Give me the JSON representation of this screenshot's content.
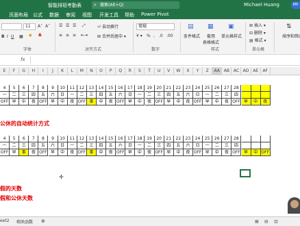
{
  "title_bar": {
    "filename": "智能排班考勤表",
    "search_placeholder": "搜索(Alt+Q)",
    "user": "Michael Huang",
    "badge": "MH"
  },
  "tabs": [
    "页面布局",
    "公式",
    "数据",
    "审阅",
    "视图",
    "开发工具",
    "帮助",
    "Power Pivot"
  ],
  "ribbon": {
    "font_size": "11",
    "wrap_text": "自动换行",
    "merge_center": "合并后居中",
    "number_format": "常规",
    "conditional_format": "条件格式",
    "format_table": "套用\n表格格式",
    "cell_styles": "单元格样式",
    "insert": "插入",
    "delete": "删除",
    "format": "格式",
    "sort_filter": "排序和筛选",
    "groups": {
      "font": "字体",
      "alignment": "对齐方式",
      "number": "数字",
      "styles": "样式",
      "cells": "单元格"
    }
  },
  "column_headers": [
    "E",
    "F",
    "G",
    "H",
    "I",
    "J",
    "K",
    "L",
    "M",
    "N",
    "O",
    "P",
    "Q",
    "R",
    "S",
    "T",
    "U",
    "V",
    "W",
    "X",
    "Y",
    "Z",
    "AA",
    "AB",
    "AC",
    "AD",
    "AE",
    "AF"
  ],
  "table1": {
    "dates": [
      "4",
      "5",
      "6",
      "7",
      "8",
      "9",
      "10",
      "11",
      "12",
      "13",
      "14",
      "15",
      "16",
      "17",
      "18",
      "19",
      "20",
      "21",
      "22",
      "23",
      "24",
      "25",
      "26",
      "27",
      "28",
      "",
      "",
      ""
    ],
    "weekdays": [
      "一",
      "二",
      "三",
      "四",
      "五",
      "六",
      "日",
      "一",
      "二",
      "三",
      "四",
      "五",
      "六",
      "日",
      "一",
      "二",
      "三",
      "四",
      "五",
      "六",
      "日",
      "一",
      "二",
      "三",
      "四",
      "",
      "",
      ""
    ],
    "shifts": [
      "OFF",
      "早",
      "中",
      "夜",
      "OFF",
      "早",
      "中",
      "夜",
      "OFF",
      "事",
      "中",
      "夜",
      "OFF",
      "早",
      "中",
      "夜",
      "OFF",
      "早",
      "中",
      "夜",
      "OFF",
      "早",
      "中",
      "夜",
      "OFF",
      "早",
      "中",
      "夜"
    ]
  },
  "section_title": "公休的自动统计方式",
  "table2": {
    "dates": [
      "4",
      "5",
      "6",
      "7",
      "8",
      "9",
      "10",
      "11",
      "12",
      "13",
      "14",
      "15",
      "16",
      "17",
      "18",
      "19",
      "20",
      "21",
      "22",
      "23",
      "24",
      "25",
      "26",
      "27",
      "28",
      "",
      "",
      ""
    ],
    "weekdays": [
      "一",
      "二",
      "三",
      "四",
      "五",
      "六",
      "日",
      "一",
      "二",
      "三",
      "四",
      "五",
      "六",
      "日",
      "一",
      "二",
      "三",
      "四",
      "五",
      "六",
      "日",
      "一",
      "二",
      "三",
      "四",
      "",
      "",
      ""
    ],
    "shifts": [
      "OFF",
      "早",
      "事",
      "夜",
      "OFF",
      "早",
      "中",
      "夜",
      "OFF",
      "事",
      "中",
      "夜",
      "OFF",
      "早",
      "中",
      "夜",
      "OFF",
      "早",
      "中",
      "夜",
      "OFF",
      "早",
      "中",
      "夜",
      "OFF",
      "早",
      "中",
      "OFF"
    ]
  },
  "notes": [
    "假的天数",
    "假和公休天数"
  ],
  "sheet_tabs": [
    "eet2",
    "相关函数"
  ],
  "colors": {
    "excel_green": "#217346",
    "highlight": "#ffff00",
    "note_red": "#e00000"
  }
}
